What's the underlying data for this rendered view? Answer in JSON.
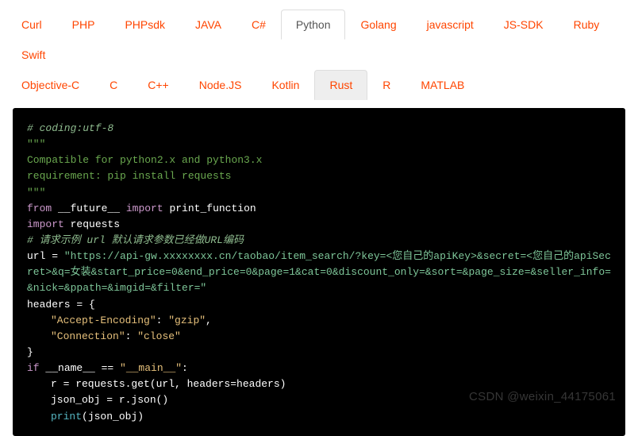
{
  "tabs": {
    "row1": [
      {
        "label": "Curl",
        "state": "normal"
      },
      {
        "label": "PHP",
        "state": "normal"
      },
      {
        "label": "PHPsdk",
        "state": "normal"
      },
      {
        "label": "JAVA",
        "state": "normal"
      },
      {
        "label": "C#",
        "state": "normal"
      },
      {
        "label": "Python",
        "state": "active"
      },
      {
        "label": "Golang",
        "state": "normal"
      },
      {
        "label": "javascript",
        "state": "normal"
      },
      {
        "label": "JS-SDK",
        "state": "normal"
      },
      {
        "label": "Ruby",
        "state": "normal"
      },
      {
        "label": "Swift",
        "state": "normal"
      }
    ],
    "row2": [
      {
        "label": "Objective-C",
        "state": "normal"
      },
      {
        "label": "C",
        "state": "normal"
      },
      {
        "label": "C++",
        "state": "normal"
      },
      {
        "label": "Node.JS",
        "state": "normal"
      },
      {
        "label": "Kotlin",
        "state": "normal"
      },
      {
        "label": "Rust",
        "state": "hover"
      },
      {
        "label": "R",
        "state": "normal"
      },
      {
        "label": "MATLAB",
        "state": "normal"
      }
    ]
  },
  "code": {
    "l1": "# coding:utf-8",
    "l2": "\"\"\"",
    "l3": "Compatible for python2.x and python3.x",
    "l4": "requirement: pip install requests",
    "l5": "\"\"\"",
    "l6a": "from",
    "l6b": " __future__ ",
    "l6c": "import",
    "l6d": " print_function",
    "l7a": "import",
    "l7b": " requests",
    "l8": "# 请求示例 url 默认请求参数已经做URL编码",
    "l9a": "url = ",
    "l9b": "\"https://api-gw.xxxxxxxx.cn/taobao/item_search/?key=<您自己的apiKey>&secret=<您自己的apiSecret>&q=女装&start_price=0&end_price=0&page=1&cat=0&discount_only=&sort=&page_size=&seller_info=&nick=&ppath=&imgid=&filter=\"",
    "l10": "headers = {",
    "l11a": "\"Accept-Encoding\"",
    "l11b": ": ",
    "l11c": "\"gzip\"",
    "l11d": ",",
    "l12a": "\"Connection\"",
    "l12b": ": ",
    "l12c": "\"close\"",
    "l13": "}",
    "l14a": "if",
    "l14b": " __name__ == ",
    "l14c": "\"__main__\"",
    "l14d": ":",
    "l15": "r = requests.get(url, headers=headers)",
    "l16": "json_obj = r.json()",
    "l17a": "print",
    "l17b": "(json_obj)"
  },
  "watermark": "CSDN @weixin_44175061"
}
